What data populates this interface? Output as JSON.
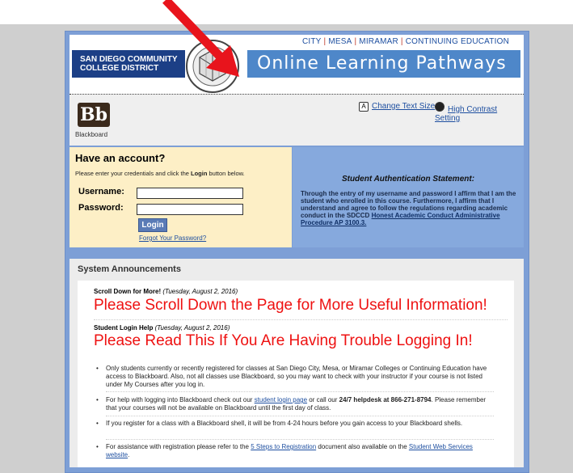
{
  "header": {
    "top_links": [
      "CITY",
      "MESA",
      "MIRAMAR",
      "CONTINUING EDUCATION"
    ],
    "district_line1": "SAN DIEGO COMMUNITY",
    "district_line2": "COLLEGE DISTRICT",
    "site_title": "Online Learning Pathways",
    "seal_text": "SAN DIEGO COMMUNITY COLLEGE DISTRICT"
  },
  "toolbar": {
    "bb_logo": "Bb",
    "bb_label": "Blackboard",
    "change_text_size": "Change Text Size",
    "change_text_size_icon_text": "A",
    "high_contrast": "High Contrast Setting"
  },
  "login": {
    "title": "Have an account?",
    "instructions_pre": "Please enter your credentials and click the ",
    "instructions_bold": "Login",
    "instructions_post": " button below.",
    "username_label": "Username:",
    "password_label": "Password:",
    "username_value": "",
    "password_value": "",
    "login_button": "Login",
    "forgot_link": "Forgot Your Password?"
  },
  "auth": {
    "title": "Student Authentication Statement:",
    "text": "Through the entry of my username and password I affirm that I am the student who enrolled in this course. Furthermore, I affirm that I understand and agree to follow the regulations regarding academic conduct in the SDCCD ",
    "link": "Honest Academic Conduct Administrative Procedure AP 3100.3."
  },
  "announcements": {
    "heading": "System Announcements",
    "items": [
      {
        "title": "Scroll Down for More!",
        "date": "(Tuesday, August 2, 2016)",
        "headline": "Please Scroll Down the Page for More Useful Information!"
      },
      {
        "title": "Student Login Help",
        "date": "(Tuesday, August 2, 2016)",
        "headline": "Please Read This If You Are Having Trouble Logging In!"
      }
    ],
    "bullets": [
      {
        "text": "Only students currently or recently registered for classes at San Diego City, Mesa, or Miramar Colleges or Continuing Education have access to Blackboard.  Also, not all classes use Blackboard, so you may want to check with your instructor if your course is not listed under My Courses after you log in."
      },
      {
        "pre": "For help with logging into Blackboard check out our ",
        "link": "student login page",
        "mid": " or call our ",
        "bold": "24/7 helpdesk at 866-271-8794",
        "post": ".  Please remember that your courses will not be available on Blackboard until the first day of class."
      },
      {
        "text": "If you register for a class with a Blackboard shell, it will be from 4-24 hours before you gain access to your Blackboard shells."
      },
      {
        "pre": "For assistance with registration please refer to the ",
        "link": "5 Steps to Registration",
        "mid": " document also available on the ",
        "link2": "Student Web Services website",
        "post": "."
      }
    ]
  },
  "colors": {
    "frame_blue": "#7d9fd6",
    "banner_blue": "#4e87c9",
    "district_navy": "#1c3f86",
    "login_panel": "#fdefc6",
    "headline_red": "#e11111",
    "arrow_red": "#e8141c"
  }
}
